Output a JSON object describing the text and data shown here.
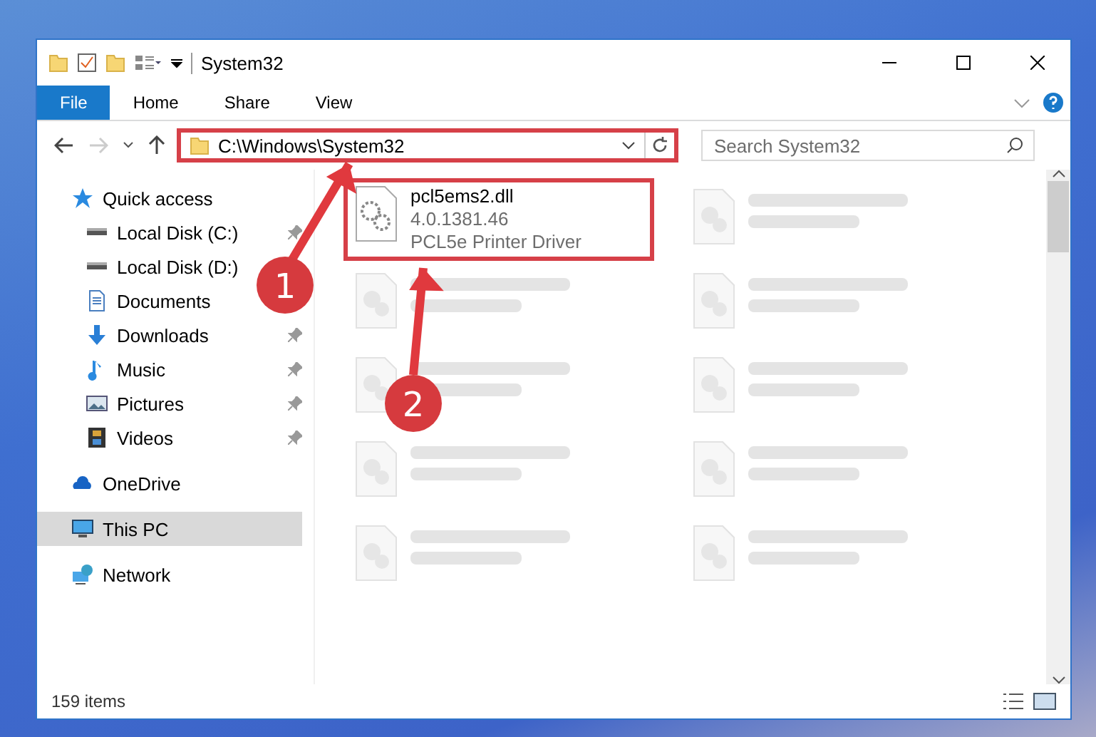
{
  "window": {
    "title": "System32"
  },
  "ribbon": {
    "tabs": [
      {
        "label": "File",
        "selected": true
      },
      {
        "label": "Home",
        "selected": false
      },
      {
        "label": "Share",
        "selected": false
      },
      {
        "label": "View",
        "selected": false
      }
    ]
  },
  "address": {
    "path": "C:\\Windows\\System32",
    "highlighted": true
  },
  "search": {
    "placeholder": "Search System32"
  },
  "sidebar": {
    "items": [
      {
        "label": "Quick access",
        "selected": false,
        "pinned": false,
        "children": [
          {
            "label": "Local Disk (C:)",
            "selected": false,
            "pinned": true
          },
          {
            "label": "Local Disk (D:)",
            "selected": false,
            "pinned": false
          },
          {
            "label": "Documents",
            "selected": false,
            "pinned": false
          },
          {
            "label": "Downloads",
            "selected": false,
            "pinned": true
          },
          {
            "label": "Music",
            "selected": false,
            "pinned": true
          },
          {
            "label": "Pictures",
            "selected": false,
            "pinned": true
          },
          {
            "label": "Videos",
            "selected": false,
            "pinned": true
          }
        ]
      },
      {
        "label": "OneDrive",
        "selected": false,
        "pinned": false
      },
      {
        "label": "This PC",
        "selected": true,
        "pinned": false
      },
      {
        "label": "Network",
        "selected": false,
        "pinned": false
      }
    ]
  },
  "files": [
    {
      "kind": "file",
      "name": "pcl5ems2.dll",
      "version": "4.0.1381.46",
      "description": "PCL5e Printer Driver",
      "highlighted": true
    },
    {
      "kind": "blurred"
    },
    {
      "kind": "blurred"
    },
    {
      "kind": "blurred"
    },
    {
      "kind": "blurred"
    },
    {
      "kind": "blurred"
    },
    {
      "kind": "blurred"
    },
    {
      "kind": "blurred"
    },
    {
      "kind": "blurred"
    },
    {
      "kind": "blurred"
    }
  ],
  "status_bar": {
    "count": "159 items"
  },
  "annotations": [
    {
      "number": "1"
    },
    {
      "number": "2"
    }
  ]
}
